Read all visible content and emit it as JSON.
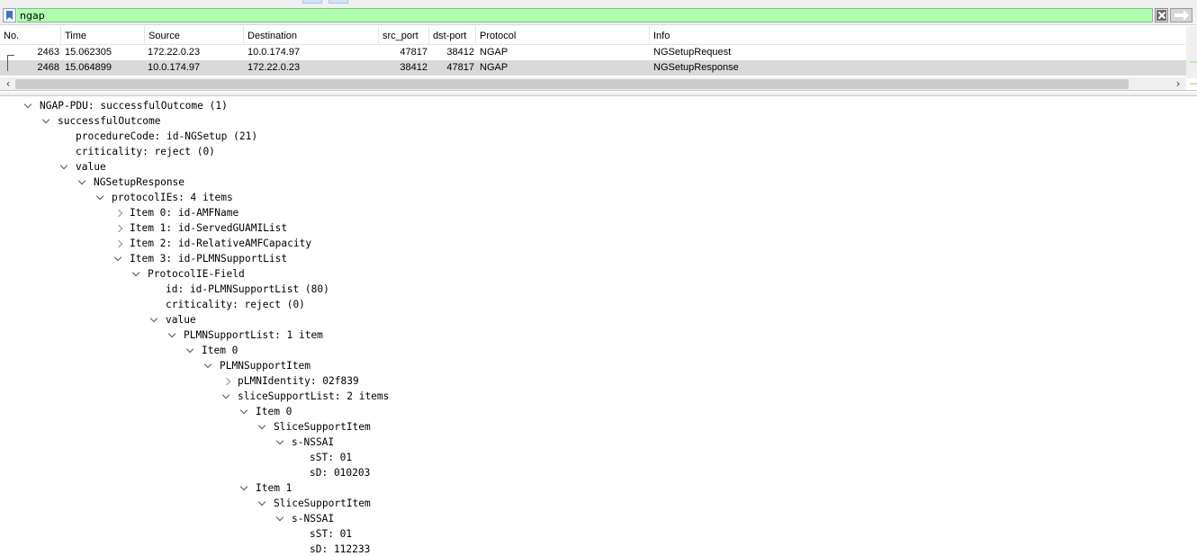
{
  "filter": {
    "value": "ngap"
  },
  "packet_list": {
    "columns": [
      "No.",
      "Time",
      "Source",
      "Destination",
      "src_port",
      "dst-port",
      "Protocol",
      "Info"
    ],
    "rows": [
      {
        "no": "2463",
        "time": "15.062305",
        "source": "172.22.0.23",
        "destination": "10.0.174.97",
        "src_port": "47817",
        "dst_port": "38412",
        "protocol": "NGAP",
        "info": "NGSetupRequest",
        "selected": false
      },
      {
        "no": "2468",
        "time": "15.064899",
        "source": "10.0.174.97",
        "destination": "172.22.0.23",
        "src_port": "38412",
        "dst_port": "47817",
        "protocol": "NGAP",
        "info": "NGSetupResponse",
        "selected": true
      }
    ]
  },
  "details": [
    {
      "text": "NGAP-PDU: successfulOutcome (1)",
      "depth": 0,
      "state": "expanded"
    },
    {
      "text": "successfulOutcome",
      "depth": 1,
      "state": "expanded"
    },
    {
      "text": "procedureCode: id-NGSetup (21)",
      "depth": 2,
      "state": "leaf"
    },
    {
      "text": "criticality: reject (0)",
      "depth": 2,
      "state": "leaf"
    },
    {
      "text": "value",
      "depth": 2,
      "state": "expanded"
    },
    {
      "text": "NGSetupResponse",
      "depth": 3,
      "state": "expanded"
    },
    {
      "text": "protocolIEs: 4 items",
      "depth": 4,
      "state": "expanded"
    },
    {
      "text": "Item 0: id-AMFName",
      "depth": 5,
      "state": "collapsed"
    },
    {
      "text": "Item 1: id-ServedGUAMIList",
      "depth": 5,
      "state": "collapsed"
    },
    {
      "text": "Item 2: id-RelativeAMFCapacity",
      "depth": 5,
      "state": "collapsed"
    },
    {
      "text": "Item 3: id-PLMNSupportList",
      "depth": 5,
      "state": "expanded"
    },
    {
      "text": "ProtocolIE-Field",
      "depth": 6,
      "state": "expanded"
    },
    {
      "text": "id: id-PLMNSupportList (80)",
      "depth": 7,
      "state": "leaf"
    },
    {
      "text": "criticality: reject (0)",
      "depth": 7,
      "state": "leaf"
    },
    {
      "text": "value",
      "depth": 7,
      "state": "expanded"
    },
    {
      "text": "PLMNSupportList: 1 item",
      "depth": 8,
      "state": "expanded"
    },
    {
      "text": "Item 0",
      "depth": 9,
      "state": "expanded"
    },
    {
      "text": "PLMNSupportItem",
      "depth": 10,
      "state": "expanded"
    },
    {
      "text": "pLMNIdentity: 02f839",
      "depth": 11,
      "state": "collapsed"
    },
    {
      "text": "sliceSupportList: 2 items",
      "depth": 11,
      "state": "expanded"
    },
    {
      "text": "Item 0",
      "depth": 12,
      "state": "expanded"
    },
    {
      "text": "SliceSupportItem",
      "depth": 13,
      "state": "expanded"
    },
    {
      "text": "s-NSSAI",
      "depth": 14,
      "state": "expanded"
    },
    {
      "text": "sST: 01",
      "depth": 15,
      "state": "leaf"
    },
    {
      "text": "sD: 010203",
      "depth": 15,
      "state": "leaf"
    },
    {
      "text": "Item 1",
      "depth": 12,
      "state": "expanded"
    },
    {
      "text": "SliceSupportItem",
      "depth": 13,
      "state": "expanded"
    },
    {
      "text": "s-NSSAI",
      "depth": 14,
      "state": "expanded"
    },
    {
      "text": "sST: 01",
      "depth": 15,
      "state": "leaf"
    },
    {
      "text": "sD: 112233",
      "depth": 15,
      "state": "leaf"
    }
  ]
}
